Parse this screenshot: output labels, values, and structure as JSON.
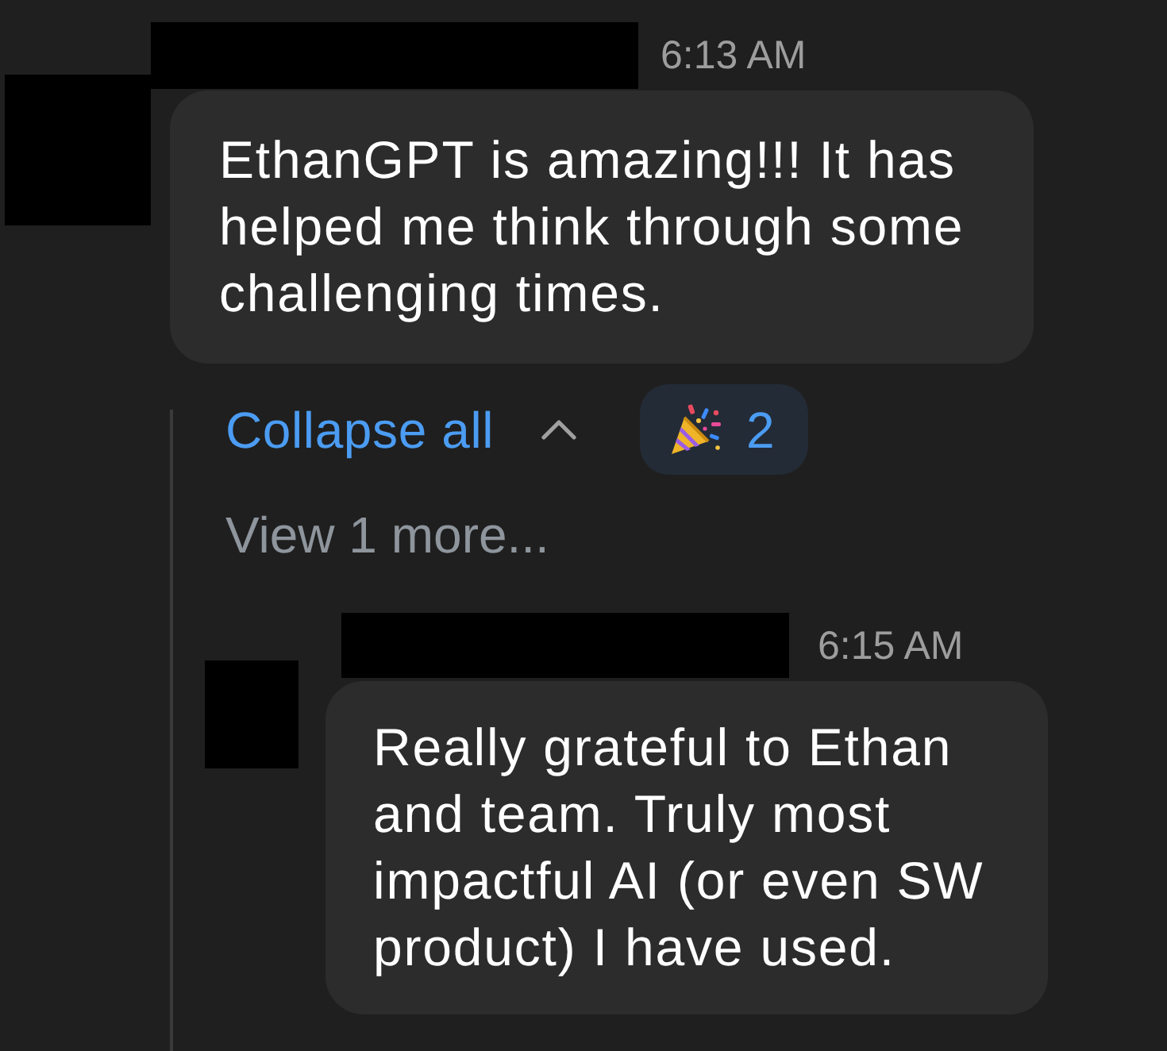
{
  "messages": [
    {
      "time": "6:13 AM",
      "text": "EthanGPT is amazing!!! It has helped me think through some challenging times.",
      "reactions": [
        {
          "count": "2",
          "selected": true
        }
      ],
      "thread": {
        "expanded": true,
        "collapse_label": "Collapse all",
        "view_more": "View 1 more...",
        "replies": [
          {
            "time": "6:15 AM",
            "text": "Really grateful to Ethan and team. Truly most impactful AI (or even SW product) I have used."
          }
        ]
      }
    }
  ]
}
